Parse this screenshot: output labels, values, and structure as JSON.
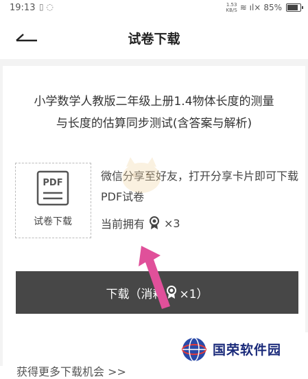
{
  "status_bar": {
    "time": "19:13",
    "left_icons": "▯ ◌",
    "net_speed_top": "1.53",
    "net_speed_bottom": "KB/S",
    "signal": "≋ ıl×",
    "battery_percent": "85%"
  },
  "header": {
    "title": "试卷下载"
  },
  "document": {
    "title_line1": "小学数学人教版二年级上册1.4物体长度的测量",
    "title_line2": "与长度的估算同步测试(含答案与解析)"
  },
  "pdf_card": {
    "icon_text": "PDF",
    "label": "试卷下载"
  },
  "share": {
    "text": "微信分享至好友，打开分享卡片即可下载PDF试卷",
    "owned_prefix": "当前拥有",
    "owned_count": "×3"
  },
  "download_button": {
    "label_prefix": "下载（消耗",
    "label_suffix": "×1）"
  },
  "more_link": {
    "label": "获得更多下载机会 >>"
  },
  "logo": {
    "text": "国荣软件园"
  },
  "colors": {
    "button_bg": "#474747",
    "page_bg": "#f3f3f3",
    "arrow": "#e0509a",
    "logo_text": "#1a2a7a"
  }
}
